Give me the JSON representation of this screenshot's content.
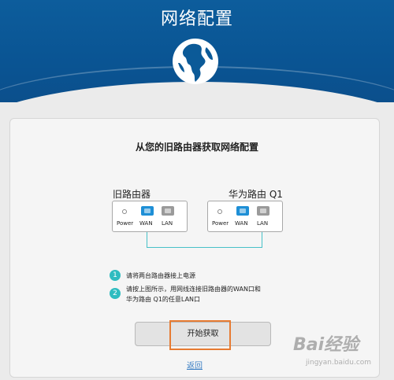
{
  "header": {
    "title": "网络配置"
  },
  "main": {
    "section_title": "从您的旧路由器获取网络配置",
    "old_router": {
      "name": "旧路由器",
      "ports": {
        "power": "Power",
        "wan": "WAN",
        "lan": "LAN"
      }
    },
    "new_router": {
      "name": "华为路由 Q1",
      "ports": {
        "power": "Power",
        "wan": "WAN",
        "lan": "LAN"
      }
    },
    "steps": [
      {
        "number": "1",
        "text": "请将两台路由器接上电源"
      },
      {
        "number": "2",
        "line1": "请按上图所示，用网线连接旧路由器的WAN口和",
        "line2": "华为路由 Q1的任意LAN口"
      }
    ],
    "start_button_label": "开始获取",
    "back_link_label": "返回"
  },
  "watermark": {
    "logo": "Bai经验",
    "sub": "jingyan.baidu.com"
  },
  "colors": {
    "header_blue": "#0a5594",
    "wan_port": "#1e8fd6",
    "cable": "#47c1c8",
    "step_badge": "#2fbcc0",
    "highlight": "#e77b32",
    "link": "#3b7fc4"
  },
  "icons": {
    "header": "globe-icon",
    "power": "power-indicator-icon",
    "wan": "ethernet-port-icon",
    "lan": "ethernet-port-icon"
  }
}
